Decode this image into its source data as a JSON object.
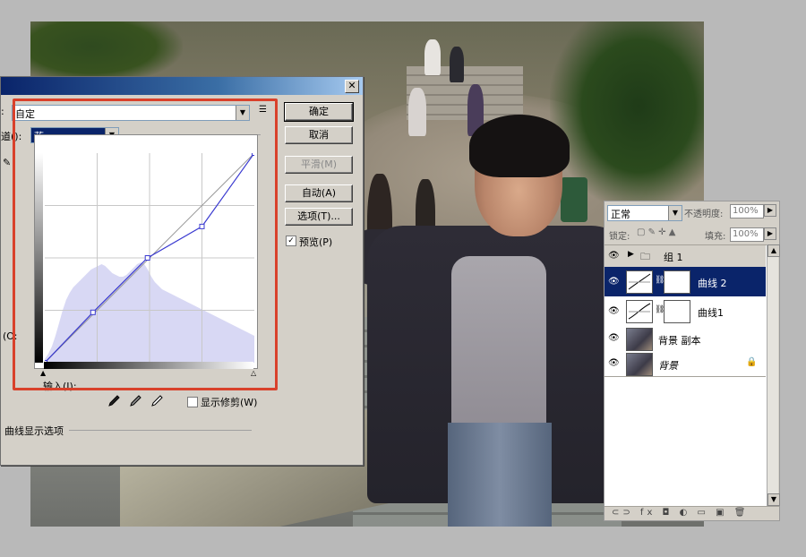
{
  "dialog": {
    "preset_label_tail": ":",
    "preset_value": "自定",
    "channel_label": "道(",
    "channel_label_tail": "):",
    "channel_value": "蓝",
    "output_label": "(O:",
    "input_label": "输入(I):",
    "buttons": {
      "ok": "确定",
      "cancel": "取消",
      "smooth": "平滑(M)",
      "auto": "自动(A)",
      "options": "选项(T)..."
    },
    "preview_label": "预览(P)",
    "show_clipping_label": "显示修剪(W)",
    "display_options_label": "曲线显示选项",
    "curve_points": [
      [
        0,
        0
      ],
      [
        0.23,
        0.24
      ],
      [
        0.49,
        0.5
      ],
      [
        0.75,
        0.65
      ],
      [
        1,
        1
      ]
    ]
  },
  "layers": {
    "blend_mode": "正常",
    "opacity_label": "不透明度:",
    "opacity_value": "100%",
    "lock_label": "锁定:",
    "fill_label": "填充:",
    "fill_value": "100%",
    "items": [
      {
        "name": "组 1"
      },
      {
        "name": "曲线 2"
      },
      {
        "name": "曲线1"
      },
      {
        "name": "背景 副本"
      },
      {
        "name": "背景"
      }
    ],
    "bottom_icons": "⊂⊃  fx  ◘  ◐  ▭  ▣  🗑"
  },
  "colors": {
    "highlight_box": "#d9412b",
    "selection": "#0a246a",
    "curve": "#3a3ad0"
  }
}
